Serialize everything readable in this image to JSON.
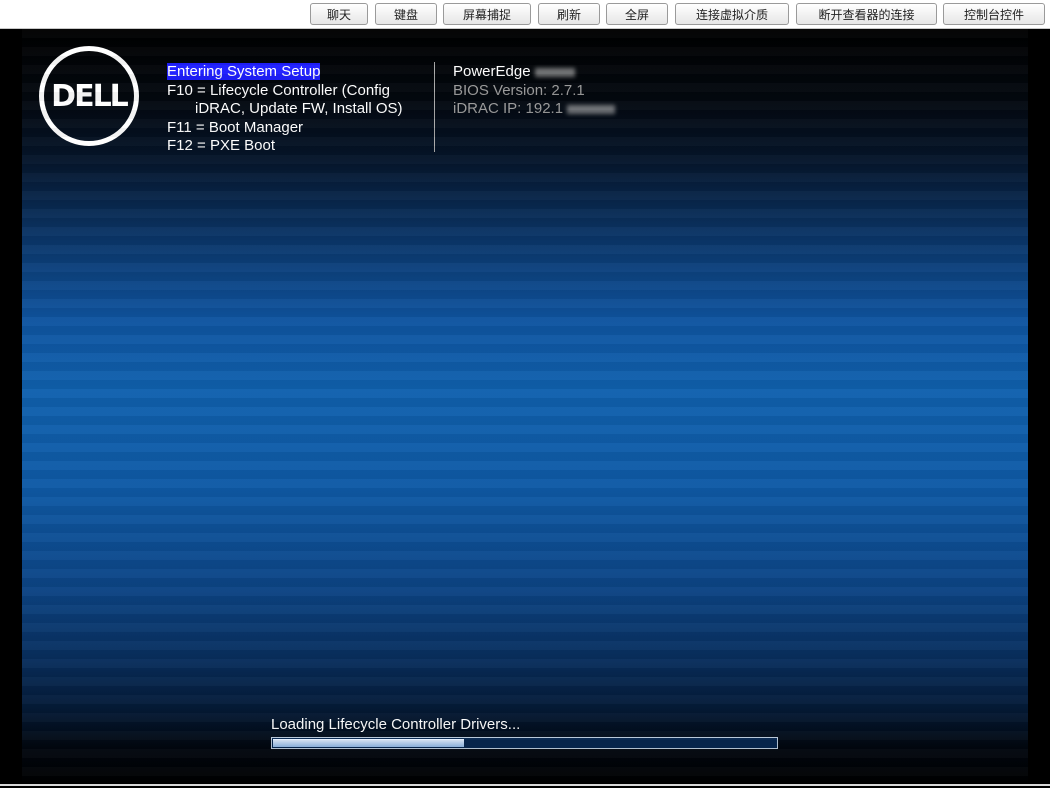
{
  "toolbar": {
    "buttons": [
      "聊天",
      "键盘",
      "屏幕捕捉",
      "刷新",
      "全屏",
      "连接虚拟介质",
      "断开查看器的连接",
      "控制台控件"
    ]
  },
  "logo": {
    "text": "DELL"
  },
  "boot_options": {
    "entering_setup": "Entering System Setup",
    "f10_line1": "F10 = Lifecycle Controller (Config",
    "f10_line2": "iDRAC, Update FW, Install OS)",
    "f11": "F11 = Boot Manager",
    "f12": "F12 = PXE Boot"
  },
  "system_info": {
    "model": "PowerEdge",
    "bios_version": "BIOS Version: 2.7.1",
    "idrac_ip": "iDRAC IP:  192.1"
  },
  "loading": {
    "label": "Loading Lifecycle Controller Drivers...",
    "progress": 0.38
  }
}
